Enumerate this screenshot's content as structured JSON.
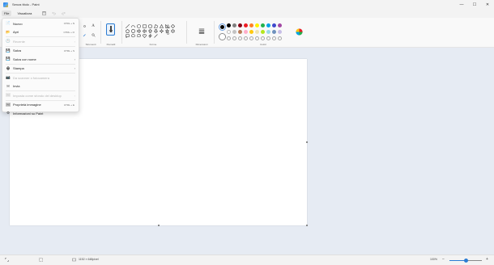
{
  "window": {
    "title": "Senza titolo - Paint",
    "minimize_glyph": "—",
    "maximize_glyph": "☐",
    "close_glyph": "✕"
  },
  "menubar": {
    "file": "File",
    "view": "Visualizza",
    "save_icon": "floppy-icon",
    "undo_icon": "undo-icon",
    "redo_icon": "redo-icon"
  },
  "ribbon": {
    "groups": {
      "tools": "Strumenti",
      "brushes": "Pennelli",
      "shapes": "Forme",
      "size": "Dimensioni",
      "colors": "Colori"
    }
  },
  "file_menu": {
    "items": [
      {
        "label": "Nuovo",
        "icon": "📄",
        "shortcut": "CTRL + N",
        "disabled": false
      },
      {
        "label": "Apri",
        "icon": "📂",
        "shortcut": "CTRL + O",
        "disabled": false
      },
      {
        "label": "Recente",
        "icon": "🕒",
        "shortcut": "›",
        "disabled": true
      },
      {
        "label": "Salva",
        "icon": "💾",
        "shortcut": "CTRL + S",
        "disabled": false
      },
      {
        "label": "Salva con nome",
        "icon": "💾",
        "shortcut": "›",
        "disabled": false
      },
      {
        "label": "Stampa",
        "icon": "🖶",
        "shortcut": "›",
        "disabled": false
      },
      {
        "label": "Da scanner o fotocamera",
        "icon": "📷",
        "shortcut": "",
        "disabled": true
      },
      {
        "label": "Invia",
        "icon": "✉",
        "shortcut": "",
        "disabled": false
      },
      {
        "label": "Imposta come sfondo del desktop",
        "icon": "🖼",
        "shortcut": "›",
        "disabled": true
      },
      {
        "label": "Proprietà immagine",
        "icon": "🖼",
        "shortcut": "CTRL + E",
        "disabled": false
      },
      {
        "label": "Informazioni su Paint",
        "icon": "⚙",
        "shortcut": "",
        "disabled": false
      }
    ]
  },
  "colors": {
    "primary": "#000000",
    "secondary": "#ffffff",
    "palette": [
      "#000000",
      "#7f7f7f",
      "#880015",
      "#ed1c24",
      "#ff7f27",
      "#fff200",
      "#22b14c",
      "#00a2e8",
      "#3f48cc",
      "#a349a4",
      "#ffffff",
      "#c3c3c3",
      "#b97a57",
      "#ffaec9",
      "#ffc90e",
      "#efe4b0",
      "#b5e61d",
      "#99d9ea",
      "#7092be",
      "#c8bfe7"
    ]
  },
  "statusbar": {
    "canvas_size": "1152 × 648pixel",
    "zoom": "100%",
    "zoom_fraction": 0.5
  }
}
